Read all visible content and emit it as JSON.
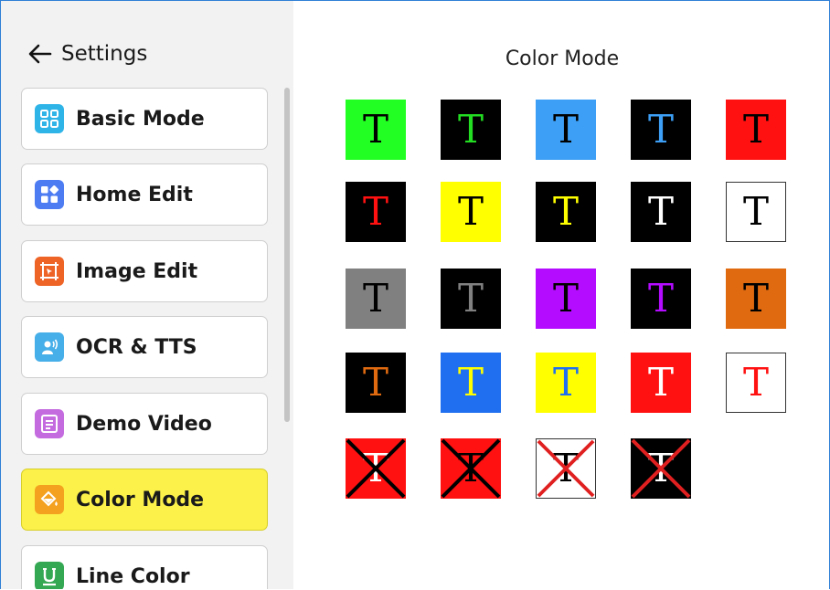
{
  "header": {
    "title": "Settings"
  },
  "sidebar": {
    "items": [
      {
        "label": "Basic Mode",
        "icon": "basic-mode-icon",
        "color": "#2fb4e8",
        "active": false
      },
      {
        "label": "Home Edit",
        "icon": "home-edit-icon",
        "color": "#4d7cf2",
        "active": false
      },
      {
        "label": "Image Edit",
        "icon": "image-edit-icon",
        "color": "#ee6326",
        "active": false
      },
      {
        "label": "OCR & TTS",
        "icon": "ocr-tts-icon",
        "color": "#46aee8",
        "active": false
      },
      {
        "label": "Demo Video",
        "icon": "demo-video-icon",
        "color": "#c46bdf",
        "active": false
      },
      {
        "label": "Color Mode",
        "icon": "color-mode-icon",
        "color": "#f4a11f",
        "active": true
      },
      {
        "label": "Line Color",
        "icon": "line-color-icon",
        "color": "#34a853",
        "active": false
      }
    ]
  },
  "main": {
    "title": "Color Mode",
    "tiles": [
      {
        "letter": "T",
        "bg": "#22ff22",
        "fg": "#000000"
      },
      {
        "letter": "T",
        "bg": "#000000",
        "fg": "#22dd22"
      },
      {
        "letter": "T",
        "bg": "#3d9ff5",
        "fg": "#000000"
      },
      {
        "letter": "T",
        "bg": "#000000",
        "fg": "#3d9ff5"
      },
      {
        "letter": "T",
        "bg": "#ff1111",
        "fg": "#000000"
      },
      {
        "letter": "T",
        "bg": "#000000",
        "fg": "#ff1111"
      },
      {
        "letter": "T",
        "bg": "#ffff00",
        "fg": "#000000"
      },
      {
        "letter": "T",
        "bg": "#000000",
        "fg": "#ffff00"
      },
      {
        "letter": "T",
        "bg": "#000000",
        "fg": "#ffffff"
      },
      {
        "letter": "T",
        "bg": "#ffffff",
        "fg": "#000000",
        "border": true
      },
      {
        "letter": "T",
        "bg": "#808080",
        "fg": "#000000"
      },
      {
        "letter": "T",
        "bg": "#000000",
        "fg": "#808080"
      },
      {
        "letter": "T",
        "bg": "#b30cff",
        "fg": "#000000"
      },
      {
        "letter": "T",
        "bg": "#000000",
        "fg": "#b30cff"
      },
      {
        "letter": "T",
        "bg": "#e06a10",
        "fg": "#000000"
      },
      {
        "letter": "T",
        "bg": "#000000",
        "fg": "#e06a10"
      },
      {
        "letter": "T",
        "bg": "#1f6ff0",
        "fg": "#ffff00"
      },
      {
        "letter": "T",
        "bg": "#ffff00",
        "fg": "#1f6ff0"
      },
      {
        "letter": "T",
        "bg": "#ff1111",
        "fg": "#ffffff"
      },
      {
        "letter": "T",
        "bg": "#ffffff",
        "fg": "#ff1111",
        "border": true
      },
      {
        "letter": "T",
        "bg": "#ff1111",
        "fg": "#ffffff",
        "crossed": true,
        "crossColor": "#000000"
      },
      {
        "letter": "T",
        "bg": "#ff1111",
        "fg": "#000000",
        "crossed": true,
        "crossColor": "#000000"
      },
      {
        "letter": "T",
        "bg": "#ffffff",
        "fg": "#000000",
        "crossed": true,
        "crossColor": "#e02020",
        "border": true
      },
      {
        "letter": "T",
        "bg": "#000000",
        "fg": "#ffffff",
        "crossed": true,
        "crossColor": "#e02020"
      }
    ]
  }
}
